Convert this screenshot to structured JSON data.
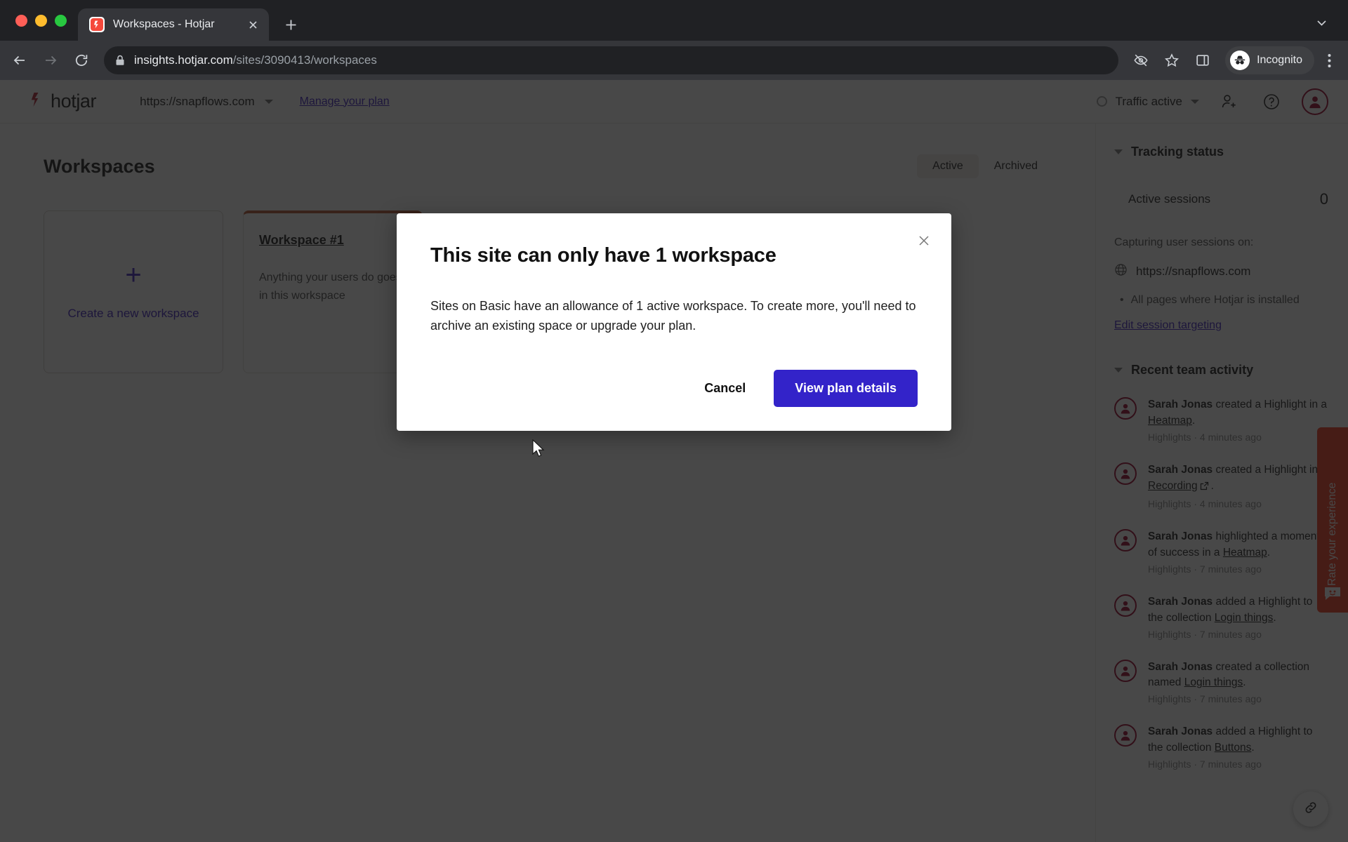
{
  "browser": {
    "tab": {
      "title": "Workspaces - Hotjar",
      "favicon": "hotjar-favicon",
      "close_icon": "close-icon"
    },
    "new_tab_icon": "plus-icon",
    "window_list_icon": "chevron-down-icon",
    "back_icon": "arrow-back-icon",
    "forward_icon": "arrow-forward-icon",
    "reload_icon": "reload-icon",
    "lock_icon": "lock-icon",
    "url_domain": "insights.hotjar.com",
    "url_path": "/sites/3090413/workspaces",
    "url_full": "insights.hotjar.com/sites/3090413/workspaces",
    "tracking_protection_icon": "eye-slash-icon",
    "bookmark_icon": "star-icon",
    "side_panel_icon": "side-panel-icon",
    "incognito_label": "Incognito",
    "incognito_icon": "incognito-icon",
    "menu_icon": "kebab-menu-icon"
  },
  "app_header": {
    "logo_text": "hotjar",
    "logo_icon": "hotjar-logo-icon",
    "site_url": "https://snapflows.com",
    "site_caret_icon": "caret-down-icon",
    "manage_plan_label": "Manage your plan",
    "traffic_status_label": "Traffic active",
    "traffic_status_icon": "status-ring-icon",
    "traffic_caret_icon": "caret-down-icon",
    "invite_icon": "add-user-icon",
    "help_icon": "help-circle-icon",
    "avatar_icon": "user-avatar-icon"
  },
  "main": {
    "page_title": "Workspaces",
    "tabs": [
      {
        "label": "Active",
        "active": true
      },
      {
        "label": "Archived",
        "active": false
      }
    ],
    "create_card": {
      "plus_icon": "plus-icon",
      "label": "Create a new workspace"
    },
    "workspace_card": {
      "name": "Workspace #1",
      "description": "Anything your users do goes in this workspace",
      "accent_color": "#b4542e"
    }
  },
  "sidebar": {
    "tracking": {
      "title": "Tracking status",
      "caret_icon": "caret-down-icon",
      "active_sessions_label": "Active sessions",
      "active_sessions_value": "0",
      "capturing_label": "Capturing user sessions on:",
      "globe_icon": "globe-icon",
      "site_url": "https://snapflows.com",
      "bullet_text": "All pages where Hotjar is installed",
      "edit_link": "Edit session targeting"
    },
    "activity": {
      "title": "Recent team activity",
      "caret_icon": "caret-down-icon",
      "items": [
        {
          "avatar_icon": "user-avatar-icon",
          "actor": "Sarah Jonas",
          "action_before": " created a Highlight in a ",
          "link": "Heatmap",
          "external_icon": false,
          "action_after": ".",
          "meta": "Highlights · 4 minutes ago"
        },
        {
          "avatar_icon": "user-avatar-icon",
          "actor": "Sarah Jonas",
          "action_before": " created a Highlight in a ",
          "link": "Recording",
          "external_icon": true,
          "action_after": ".",
          "meta": "Highlights · 4 minutes ago"
        },
        {
          "avatar_icon": "user-avatar-icon",
          "actor": "Sarah Jonas",
          "action_before": " highlighted a moment of success in a ",
          "link": "Heatmap",
          "external_icon": false,
          "action_after": ".",
          "meta": "Highlights · 7 minutes ago"
        },
        {
          "avatar_icon": "user-avatar-icon",
          "actor": "Sarah Jonas",
          "action_before": " added a Highlight to the collection ",
          "link": "Login things",
          "external_icon": false,
          "action_after": ".",
          "meta": "Highlights · 7 minutes ago"
        },
        {
          "avatar_icon": "user-avatar-icon",
          "actor": "Sarah Jonas",
          "action_before": " created a collection named ",
          "link": "Login things",
          "external_icon": false,
          "action_after": ".",
          "meta": "Highlights · 7 minutes ago"
        },
        {
          "avatar_icon": "user-avatar-icon",
          "actor": "Sarah Jonas",
          "action_before": " added a Highlight to the collection ",
          "link": "Buttons",
          "external_icon": false,
          "action_after": ".",
          "meta": "Highlights · 7 minutes ago"
        }
      ]
    }
  },
  "rate_tab": {
    "label": "Rate your experience",
    "icon": "smiley-face-icon",
    "color": "#f4381b"
  },
  "fab": {
    "icon": "link-icon"
  },
  "modal": {
    "title": "This site can only have 1 workspace",
    "body": "Sites on Basic have an allowance of 1 active workspace. To create more, you'll need to archive an existing space or upgrade your plan.",
    "cancel_label": "Cancel",
    "primary_label": "View plan details",
    "primary_color": "#3323c9",
    "close_icon": "close-icon"
  }
}
